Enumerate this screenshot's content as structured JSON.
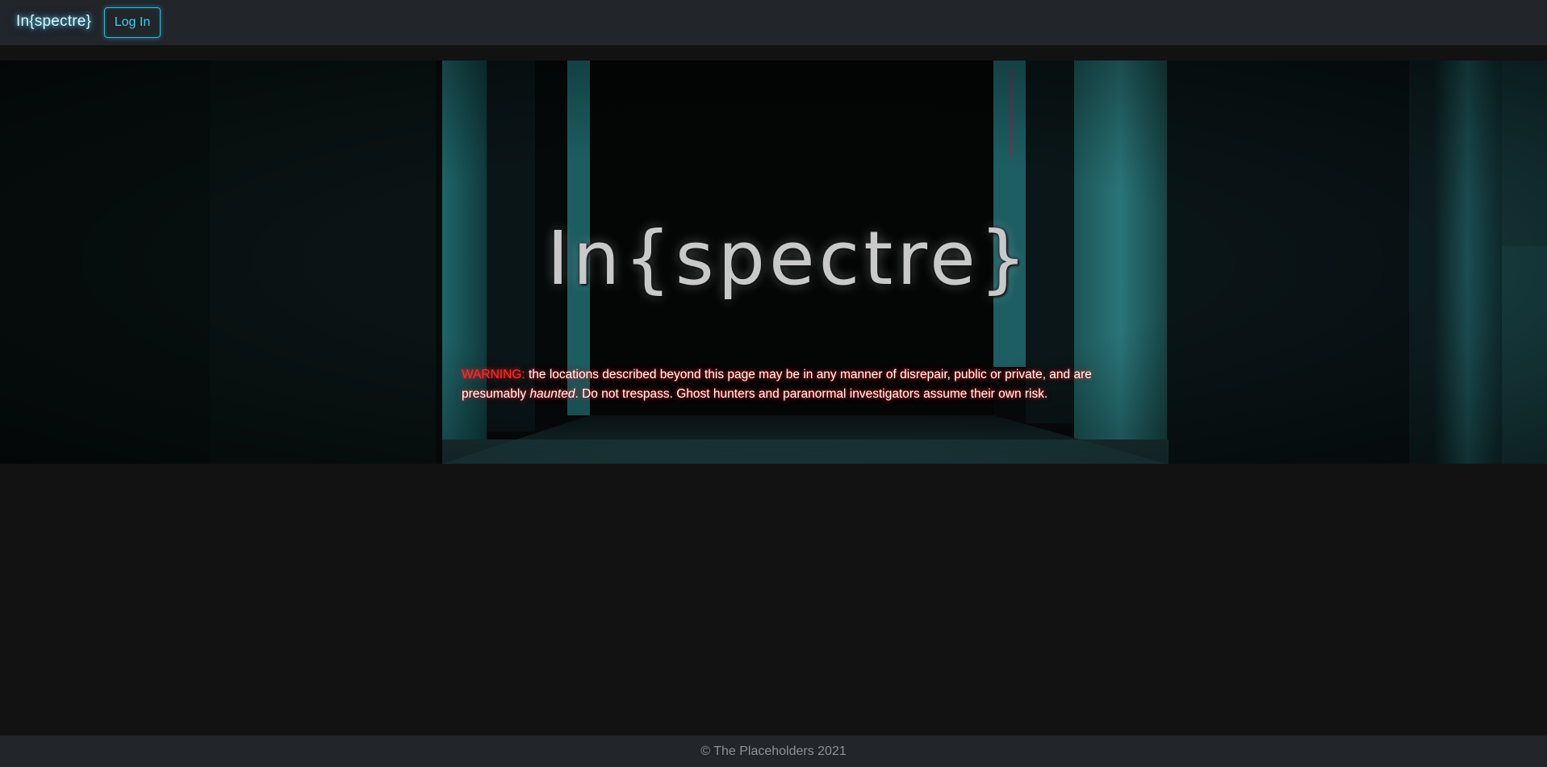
{
  "navbar": {
    "brand": "In{spectre}",
    "login_label": "Log In"
  },
  "hero": {
    "title": "In{spectre}",
    "warning_label": "WARNING:",
    "warning_text_1": " the locations described beyond this page may be in any manner of disrepair, public or private, and are presumably ",
    "warning_emphasis": "haunted",
    "warning_text_2": ". Do not trespass. Ghost hunters and paranormal investigators assume their own risk."
  },
  "footer": {
    "copyright": "© The Placeholders 2021"
  },
  "colors": {
    "navbar_bg": "#22252a",
    "page_bg": "#121212",
    "accent_cyan": "#27b9d9",
    "warning_red": "#ff2a2a"
  }
}
